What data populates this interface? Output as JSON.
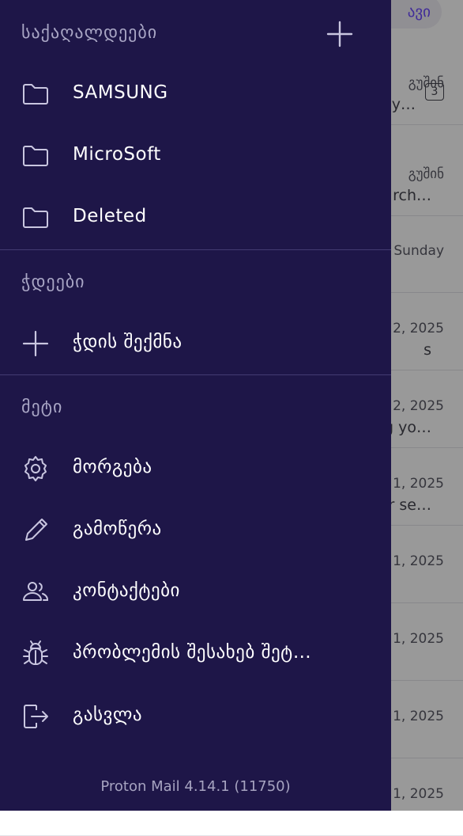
{
  "inbox": {
    "top_button_label": "ავი",
    "rows": [
      {
        "date": "გუშინ",
        "subject": "y…",
        "count": "3"
      },
      {
        "date": "გუშინ",
        "subject": "rch…"
      },
      {
        "date": "Sunday",
        "subject": ""
      },
      {
        "date": "2, 2025",
        "subject": "s"
      },
      {
        "date": "2, 2025",
        "subject": "g yo…"
      },
      {
        "date": "1, 2025",
        "subject": "r se…"
      },
      {
        "date": "1, 2025",
        "subject": ""
      },
      {
        "date": "1, 2025",
        "subject": ""
      },
      {
        "date": "1, 2025",
        "subject": ""
      },
      {
        "date": "1, 2025",
        "subject": ""
      }
    ]
  },
  "drawer": {
    "folders_heading": "საქაღალდეები",
    "folders": [
      {
        "label": "SAMSUNG",
        "icon": "folder-icon"
      },
      {
        "label": "MicroSoft",
        "icon": "folder-icon"
      },
      {
        "label": "Deleted",
        "icon": "folder-icon"
      }
    ],
    "labels_heading": "ჭდეები",
    "create_label": "ჭდის შექმნა",
    "more_heading": "მეტი",
    "more_items": [
      {
        "label": "მორგება",
        "icon": "gear-icon"
      },
      {
        "label": "გამოწერა",
        "icon": "pencil-icon"
      },
      {
        "label": "კონტაქტები",
        "icon": "contacts-icon"
      },
      {
        "label": "პრობლემის შესახებ შეტ…",
        "icon": "bug-icon"
      },
      {
        "label": "გასვლა",
        "icon": "logout-icon"
      }
    ],
    "version": "Proton Mail 4.14.1 (11750)"
  },
  "colors": {
    "drawer_bg": "#1e1648",
    "heading": "#a9a6c5",
    "accent": "#6d4aff"
  }
}
